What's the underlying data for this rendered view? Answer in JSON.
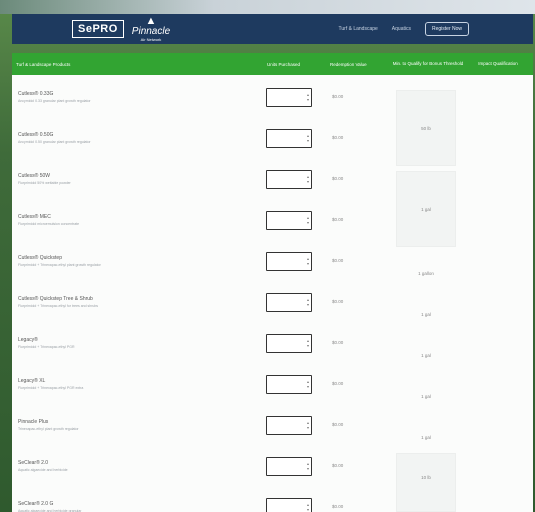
{
  "header": {
    "logo_sepro": "SePRO",
    "logo_pinnacle": "Pinnacle",
    "logo_pinnacle_sub": "Air Network",
    "nav": [
      {
        "label": "Turf & Landscape"
      },
      {
        "label": "Aquatics"
      }
    ],
    "register_label": "Register Now"
  },
  "table": {
    "headers": {
      "product": "Turf & Landscape Products",
      "units": "Units Purchased",
      "redemption": "Redemption Value",
      "acres": "Min. to Qualify for Bonus Threshold",
      "impact": "Impact Qualification"
    },
    "rows": [
      {
        "name": "Cutless® 0.33G",
        "desc": "Ancymidol 0.33 granular plant growth regulator",
        "price": "$0.00"
      },
      {
        "name": "Cutless® 0.50G",
        "desc": "Ancymidol 0.50 granular plant growth regulator",
        "price": "$0.00"
      },
      {
        "name": "Cutless® 50W",
        "desc": "Flurprimidol 50% wettable powder",
        "price": "$0.00"
      },
      {
        "name": "Cutless® MEC",
        "desc": "Flurprimidol microemulsion concentrate",
        "price": "$0.00"
      },
      {
        "name": "Cutless® Quickstep",
        "desc": "Flurprimidol + Trinexapac-ethyl plant growth regulator",
        "price": "$0.00"
      },
      {
        "name": "Cutless® Quickstep Tree & Shrub",
        "desc": "Flurprimidol + Trinexapac-ethyl for trees and shrubs",
        "price": "$0.00"
      },
      {
        "name": "Legacy®",
        "desc": "Flurprimidol + Trinexapac-ethyl PGR",
        "price": "$0.00"
      },
      {
        "name": "Legacy® XL",
        "desc": "Flurprimidol + Trinexapac-ethyl PGR extra",
        "price": "$0.00"
      },
      {
        "name": "Pinnacle Plus",
        "desc": "Trinexapac-ethyl plant growth regulator",
        "price": "$0.00"
      },
      {
        "name": "SeClear® 2.0",
        "desc": "Aquatic algaecide and herbicide",
        "price": "$0.00"
      },
      {
        "name": "SeClear® 2.0 G",
        "desc": "Aquatic algaecide and herbicide granular",
        "price": "$0.00"
      }
    ],
    "qualify_values": {
      "group1": "50 lb",
      "group2": "1 gal",
      "row5": "1 gallon",
      "row6": "1 gal",
      "row7": "1 gal",
      "row8": "1 gal",
      "row9": "1 gal",
      "group10": "10 lb"
    }
  }
}
